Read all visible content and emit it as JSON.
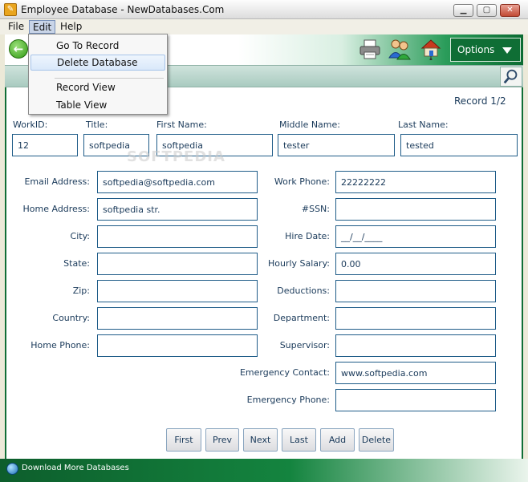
{
  "window": {
    "title": "Employee Database - NewDatabases.Com",
    "minimize": "▁",
    "maximize": "▢",
    "close": "✕"
  },
  "menubar": {
    "file": "File",
    "edit": "Edit",
    "help": "Help"
  },
  "edit_menu": {
    "go_to_record": "Go To Record",
    "delete_database": "Delete Database",
    "record_view": "Record View",
    "table_view": "Table View"
  },
  "toolbar": {
    "options_label": "Options",
    "icons": [
      "back-arrow-icon",
      "printer-icon",
      "users-icon",
      "home-network-icon"
    ]
  },
  "record": {
    "indicator": "Record 1/2"
  },
  "top_fields": {
    "workid": {
      "label": "WorkID:",
      "value": "12"
    },
    "title": {
      "label": "Title:",
      "value": "softpedia"
    },
    "first_name": {
      "label": "First Name:",
      "value": "softpedia"
    },
    "middle_name": {
      "label": "Middle Name:",
      "value": "tester"
    },
    "last_name": {
      "label": "Last Name:",
      "value": "tested"
    }
  },
  "left_fields": [
    {
      "label": "Email Address:",
      "value": "softpedia@softpedia.com"
    },
    {
      "label": "Home Address:",
      "value": "softpedia str."
    },
    {
      "label": "City:",
      "value": ""
    },
    {
      "label": "State:",
      "value": ""
    },
    {
      "label": "Zip:",
      "value": ""
    },
    {
      "label": "Country:",
      "value": ""
    },
    {
      "label": "Home Phone:",
      "value": ""
    }
  ],
  "right_fields": [
    {
      "label": "Work Phone:",
      "value": "22222222"
    },
    {
      "label": "#SSN:",
      "value": ""
    },
    {
      "label": "Hire Date:",
      "value": "__/__/____"
    },
    {
      "label": "Hourly Salary:",
      "value": "0.00"
    },
    {
      "label": "Deductions:",
      "value": ""
    },
    {
      "label": "Department:",
      "value": ""
    },
    {
      "label": "Supervisor:",
      "value": ""
    },
    {
      "label": "Emergency Contact:",
      "value": "www.softpedia.com"
    },
    {
      "label": "Emergency Phone:",
      "value": ""
    }
  ],
  "nav_buttons": {
    "first": "First",
    "prev": "Prev",
    "next": "Next",
    "last": "Last",
    "add": "Add",
    "delete": "Delete"
  },
  "status": {
    "link": "Download More Databases"
  },
  "watermark": "SOFTPEDIA",
  "colors": {
    "accent_green": "#0f6e35",
    "field_border": "#1f5c88",
    "text": "#1a3a5a"
  }
}
